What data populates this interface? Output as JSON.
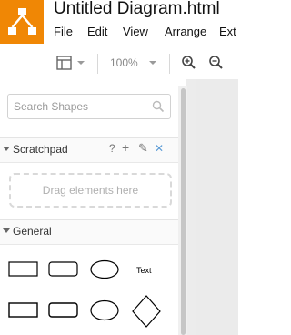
{
  "app": {
    "document_title": "Untitled Diagram.html",
    "logo_icon": "drawio-logo-icon",
    "brand_color": "#f08705"
  },
  "menu": {
    "items": [
      {
        "label": "File"
      },
      {
        "label": "Edit"
      },
      {
        "label": "View"
      },
      {
        "label": "Arrange"
      },
      {
        "label": "Ext"
      }
    ]
  },
  "toolbar": {
    "page_view_icon": "page-view-icon",
    "zoom_level": "100%",
    "zoom_in_icon": "zoom-in-icon",
    "zoom_out_icon": "zoom-out-icon"
  },
  "sidebar": {
    "search": {
      "placeholder": "Search Shapes",
      "value": ""
    },
    "scratchpad": {
      "title": "Scratchpad",
      "help_label": "?",
      "add_label": "+",
      "edit_label": "✎",
      "close_label": "✕",
      "drop_hint": "Drag elements here"
    },
    "general": {
      "title": "General",
      "text_shape_label": "Text"
    }
  }
}
